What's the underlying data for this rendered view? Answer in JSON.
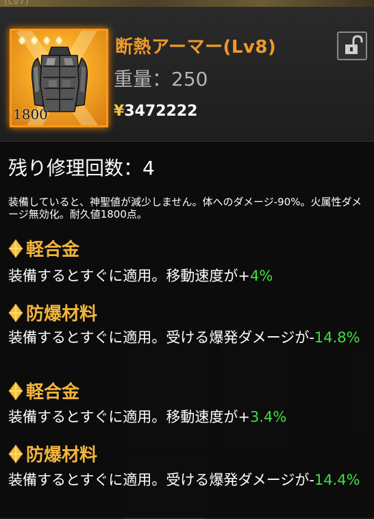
{
  "background": {
    "top_label": "(Lv7)"
  },
  "item": {
    "name": "断熱アーマー(Lv8)",
    "weight_label": "重量：",
    "weight_value": "250",
    "price_symbol": "¥",
    "price_value": "3472222",
    "durability": "1800",
    "stars": 4,
    "frame_color": "#ff9a1a",
    "icon": "armor-icon",
    "lock_icon": "unlocked-padlock-icon"
  },
  "repair": {
    "label": "残り修理回数：",
    "value": "4"
  },
  "description": "装備していると、神聖値が減少しません。体へのダメージ-90%。火属性ダメージ無効化。耐久値1800点。",
  "mods": [
    {
      "title": "軽合金",
      "text": "装備するとすぐに適用。移動速度が+",
      "value": "4%"
    },
    {
      "title": "防爆材料",
      "text": "装備するとすぐに適用。受ける爆発ダメージが-",
      "value": "14.8%"
    },
    {
      "title": "軽合金",
      "text": "装備するとすぐに適用。移動速度が+",
      "value": "3.4%"
    },
    {
      "title": "防爆材料",
      "text": "装備するとすぐに適用。受ける爆発ダメージが-",
      "value": "14.4%"
    }
  ],
  "colors": {
    "title_orange": "#f09a28",
    "mod_gold": "#f3b53a",
    "value_green": "#3fe03f"
  }
}
